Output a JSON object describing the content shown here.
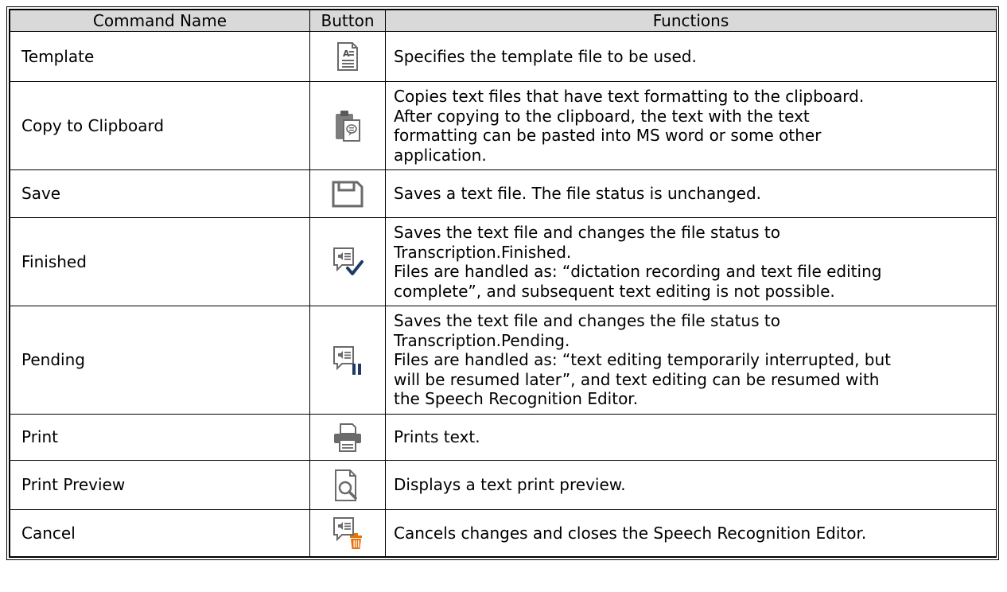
{
  "headers": {
    "command_name": "Command Name",
    "button": "Button",
    "functions": "Functions"
  },
  "rows": [
    {
      "name": "Template",
      "icon": "template-document-icon",
      "lines": [
        "Specifies the template file to be used."
      ]
    },
    {
      "name": "Copy to Clipboard",
      "icon": "copy-to-clipboard-icon",
      "lines": [
        "Copies text files that have text formatting to the clipboard.",
        "After copying to the clipboard, the text with the text",
        "formatting can be pasted into MS word or some other",
        "application."
      ]
    },
    {
      "name": "Save",
      "icon": "save-floppy-icon",
      "lines": [
        "Saves a text file. The file status is unchanged."
      ]
    },
    {
      "name": "Finished",
      "icon": "finished-checkmark-icon",
      "lines": [
        "Saves the text file and changes the file status to",
        "Transcription.Finished.",
        "Files are handled as: “dictation recording and text file editing",
        "complete”, and subsequent text editing is not possible."
      ]
    },
    {
      "name": "Pending",
      "icon": "pending-pause-icon",
      "lines": [
        "Saves the text file and changes the file status to",
        "Transcription.Pending.",
        "Files are handled as: “text editing temporarily interrupted, but",
        "will be resumed later”, and text editing can be resumed with",
        "the Speech Recognition Editor."
      ]
    },
    {
      "name": "Print",
      "icon": "printer-icon",
      "lines": [
        "Prints text."
      ]
    },
    {
      "name": "Print Preview",
      "icon": "print-preview-magnifier-icon",
      "lines": [
        "Displays a text print preview."
      ]
    },
    {
      "name": "Cancel",
      "icon": "cancel-trash-icon",
      "lines": [
        "Cancels changes and closes the Speech Recognition Editor."
      ]
    }
  ]
}
